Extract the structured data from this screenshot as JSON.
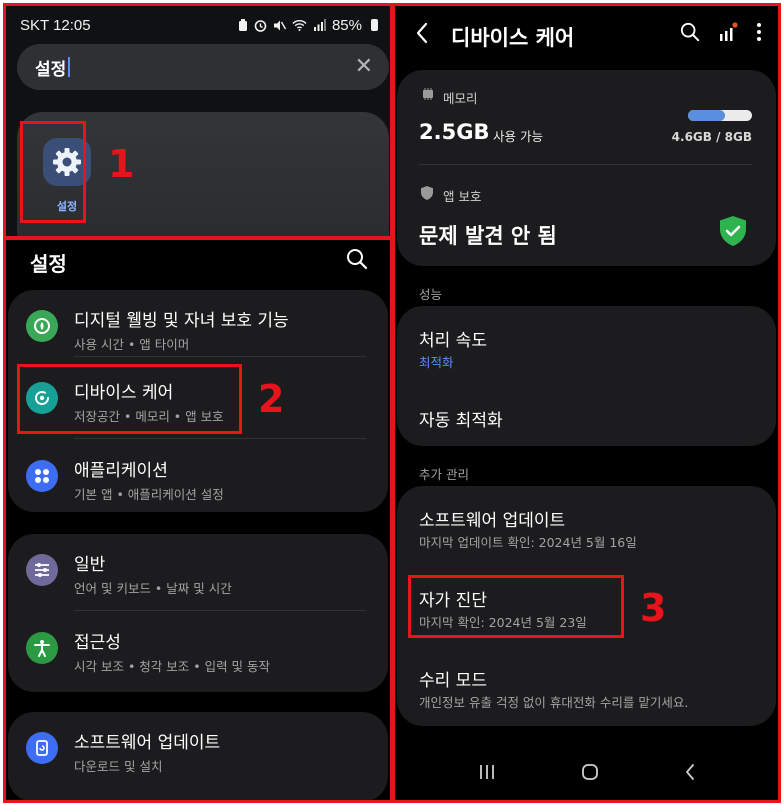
{
  "status_bar": {
    "carrier_time": "SKT 12:05",
    "battery": "85%"
  },
  "search": {
    "query": "설정"
  },
  "search_result": {
    "app_label": "설정"
  },
  "markers": [
    "1",
    "2",
    "3"
  ],
  "settings_page": {
    "title": "설정",
    "groups": [
      {
        "items": [
          {
            "title": "디지털 웰빙 및 자녀 보호 기능",
            "subtitle": "사용 시간  •  앱 타이머",
            "icon": "digital-wellbeing-icon",
            "color": "#3aa757"
          },
          {
            "title": "디바이스 케어",
            "subtitle": "저장공간  •  메모리  •  앱 보호",
            "icon": "device-care-icon",
            "color": "#16a096"
          },
          {
            "title": "애플리케이션",
            "subtitle": "기본 앱  •  애플리케이션 설정",
            "icon": "apps-icon",
            "color": "#3d6df2"
          }
        ]
      },
      {
        "items": [
          {
            "title": "일반",
            "subtitle": "언어 및 키보드  •  날짜 및 시간",
            "icon": "general-management-icon",
            "color": "#6f6a99"
          },
          {
            "title": "접근성",
            "subtitle": "시각 보조  •  청각 보조  •  입력 및 동작",
            "icon": "accessibility-icon",
            "color": "#2b9a43"
          }
        ]
      },
      {
        "items": [
          {
            "title": "소프트웨어 업데이트",
            "subtitle": "다운로드 및 설치",
            "icon": "software-update-icon",
            "color": "#3d6df2"
          }
        ]
      }
    ]
  },
  "device_care": {
    "title": "디바이스 케어",
    "memory": {
      "label": "메모리",
      "available_value": "2.5GB",
      "available_label": "사용 가능",
      "usage": "4.6GB / 8GB",
      "used_fraction": 0.575
    },
    "app_protection": {
      "label": "앱 보호",
      "status": "문제 발견 안 됨"
    },
    "performance": {
      "section_label": "성능",
      "items": [
        {
          "title": "처리 속도",
          "subtitle": "최적화"
        },
        {
          "title": "자동 최적화"
        }
      ]
    },
    "additional": {
      "section_label": "추가 관리",
      "items": [
        {
          "title": "소프트웨어 업데이트",
          "subtitle": "마지막 업데이트 확인: 2024년 5월 16일"
        },
        {
          "title": "자가 진단",
          "subtitle": "마지막 확인: 2024년 5월 23일"
        },
        {
          "title": "수리 모드",
          "subtitle": "개인정보 유출 걱정 없이 휴대전화 수리를 맡기세요."
        }
      ]
    }
  },
  "colors": {
    "highlight": "#e8141c",
    "accent_blue": "#5a8cff",
    "shield_green": "#2fb34f"
  }
}
